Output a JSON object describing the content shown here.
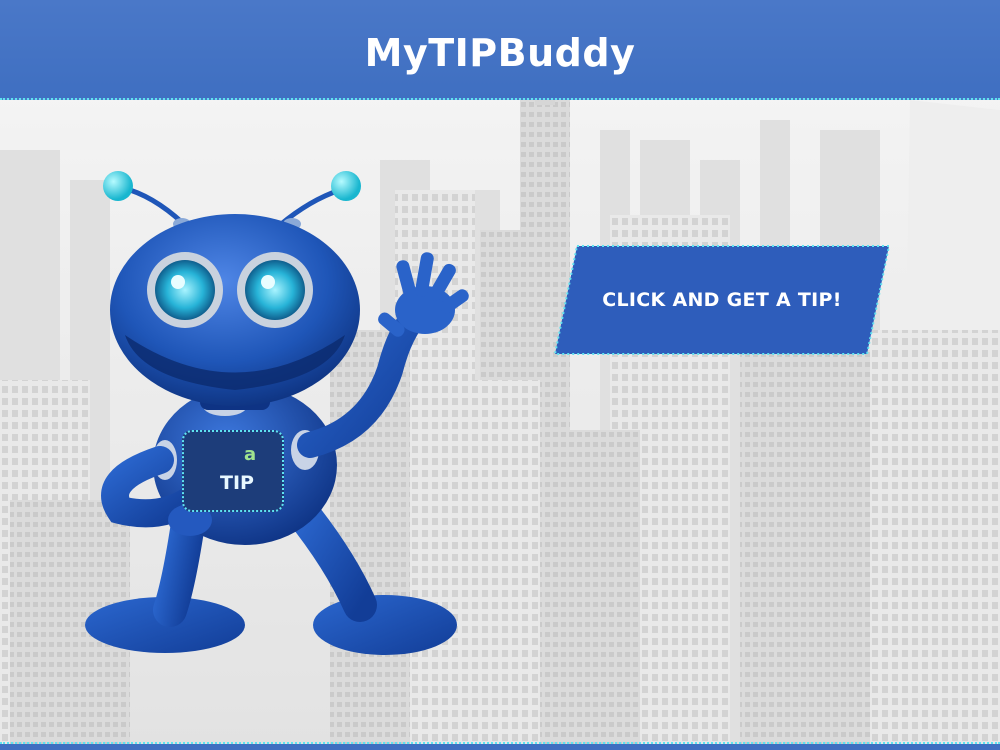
{
  "header": {
    "title": "MyTIPBuddy"
  },
  "main": {
    "tip_button_label": "CLICK AND GET A TIP!"
  },
  "robot_badge": {
    "letter": "a",
    "text": "TIP"
  },
  "colors": {
    "header_blue": "#3f6fc1",
    "button_blue": "#2e5dbb",
    "accent_cyan": "#5fe3f0",
    "robot_blue": "#1f56b8"
  }
}
